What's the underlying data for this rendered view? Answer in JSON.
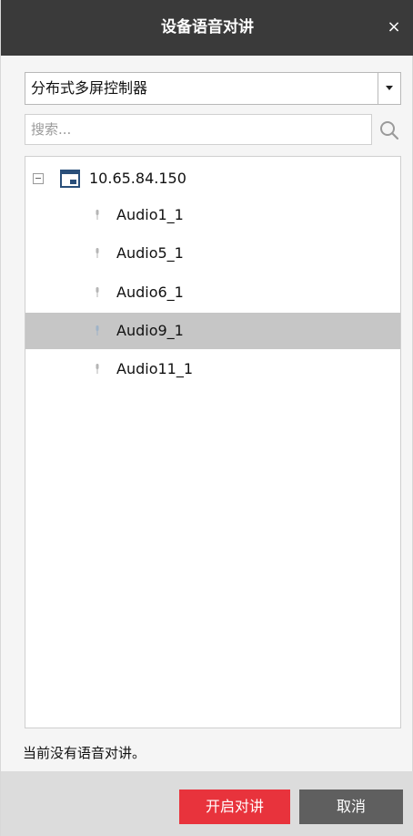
{
  "dialog": {
    "title": "设备语音对讲",
    "close_symbol": "×"
  },
  "device_select": {
    "value": "分布式多屏控制器",
    "arrow_icon": "caret-down-icon"
  },
  "search": {
    "placeholder": "搜索...",
    "value": "",
    "icon": "search-icon"
  },
  "tree": {
    "device": {
      "label": "10.65.84.150",
      "expanded": true,
      "icon": "device-icon"
    },
    "channels": [
      {
        "label": "Audio1_1",
        "selected": false
      },
      {
        "label": "Audio5_1",
        "selected": false
      },
      {
        "label": "Audio6_1",
        "selected": false
      },
      {
        "label": "Audio9_1",
        "selected": true
      },
      {
        "label": "Audio11_1",
        "selected": false
      }
    ]
  },
  "status": {
    "text": "当前没有语音对讲。"
  },
  "buttons": {
    "start_label": "开启对讲",
    "cancel_label": "取消"
  },
  "colors": {
    "titlebar": "#3a3a3a",
    "start_button": "#e8333c",
    "cancel_button": "#5f5f5f",
    "selected_row": "#c6c6c6"
  }
}
